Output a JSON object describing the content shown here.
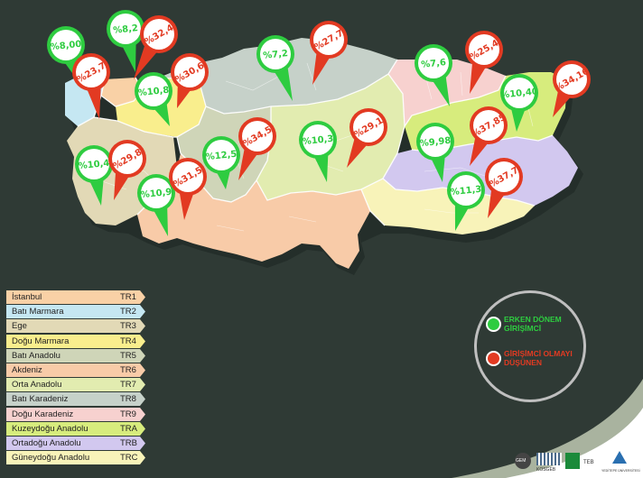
{
  "regions": [
    {
      "name": "İstanbul",
      "code": "TR1",
      "color": "#f9d1a6"
    },
    {
      "name": "Batı Marmara",
      "code": "TR2",
      "color": "#c5e7f2"
    },
    {
      "name": "Ege",
      "code": "TR3",
      "color": "#e2d9b6"
    },
    {
      "name": "Doğu Marmara",
      "code": "TR4",
      "color": "#f9ee8d"
    },
    {
      "name": "Batı Anadolu",
      "code": "TR5",
      "color": "#cfd5b8"
    },
    {
      "name": "Akdeniz",
      "code": "TR6",
      "color": "#f8cba8"
    },
    {
      "name": "Orta Anadolu",
      "code": "TR7",
      "color": "#e2ecb0"
    },
    {
      "name": "Batı Karadeniz",
      "code": "TR8",
      "color": "#c6d1c9"
    },
    {
      "name": "Doğu Karadeniz",
      "code": "TR9",
      "color": "#f7d1cf"
    },
    {
      "name": "Kuzeydoğu Anadolu",
      "code": "TRA",
      "color": "#d7ec7d"
    },
    {
      "name": "Ortadoğu Anadolu",
      "code": "TRB",
      "color": "#d2c8ef"
    },
    {
      "name": "Güneydoğu Anadolu",
      "code": "TRC",
      "color": "#f8f3b9"
    }
  ],
  "pins": [
    {
      "id": "tr1-early",
      "label": "%8,00",
      "kind": "early"
    },
    {
      "id": "tr1-think",
      "label": "%23,7",
      "kind": "think"
    },
    {
      "id": "tr2-early",
      "label": "%8,2",
      "kind": "early"
    },
    {
      "id": "tr2-think",
      "label": "%32,4",
      "kind": "think"
    },
    {
      "id": "tr4-early",
      "label": "%10,8",
      "kind": "early"
    },
    {
      "id": "tr4-think",
      "label": "%30,6",
      "kind": "think"
    },
    {
      "id": "tr3-early",
      "label": "%10,4",
      "kind": "early"
    },
    {
      "id": "tr3-think",
      "label": "%29,8",
      "kind": "think"
    },
    {
      "id": "tr6-early",
      "label": "%10,9",
      "kind": "early"
    },
    {
      "id": "tr6-think",
      "label": "%31,5",
      "kind": "think"
    },
    {
      "id": "tr5-early",
      "label": "%12,5",
      "kind": "early"
    },
    {
      "id": "tr5-think",
      "label": "%34,5",
      "kind": "think"
    },
    {
      "id": "tr8-early",
      "label": "%7,2",
      "kind": "early"
    },
    {
      "id": "tr8-think",
      "label": "%27,7",
      "kind": "think"
    },
    {
      "id": "tr7-early",
      "label": "%10,3",
      "kind": "early"
    },
    {
      "id": "tr7-think",
      "label": "%29,1",
      "kind": "think"
    },
    {
      "id": "tr9-early",
      "label": "%7,6",
      "kind": "early"
    },
    {
      "id": "tr9-think",
      "label": "%25,4",
      "kind": "think"
    },
    {
      "id": "tra-early",
      "label": "%10,40",
      "kind": "early"
    },
    {
      "id": "tra-think",
      "label": "%34,16",
      "kind": "think"
    },
    {
      "id": "trb-early",
      "label": "%9,98",
      "kind": "early"
    },
    {
      "id": "trb-think",
      "label": "%37,85",
      "kind": "think"
    },
    {
      "id": "trc-early",
      "label": "%11,3",
      "kind": "early"
    },
    {
      "id": "trc-think",
      "label": "%37,7",
      "kind": "think"
    }
  ],
  "key": {
    "early_label": "ERKEN DÖNEM GİRİŞİMCİ",
    "think_label": "GİRİŞİMCİ OLMAYI DÜŞÜNEN",
    "early_color": "#2ecc40",
    "think_color": "#e23a22"
  },
  "logos": [
    "GEM",
    "KOSGEB",
    "TEB",
    "YEDİTEPE ÜNİVERSİTESİ"
  ]
}
